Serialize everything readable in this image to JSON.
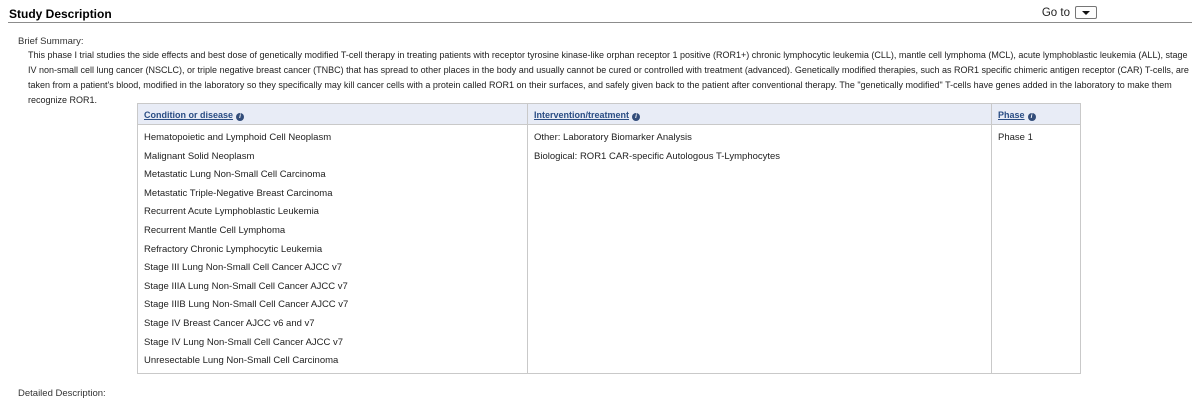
{
  "header": {
    "section_title": "Study Description",
    "goto_label": "Go to"
  },
  "brief_summary": {
    "label": "Brief Summary:",
    "text": "This phase I trial studies the side effects and best dose of genetically modified T-cell therapy in treating patients with receptor tyrosine kinase-like orphan receptor 1 positive (ROR1+) chronic lymphocytic leukemia (CLL), mantle cell lymphoma (MCL), acute lymphoblastic leukemia (ALL), stage IV non-small cell lung cancer (NSCLC), or triple negative breast cancer (TNBC) that has spread to other places in the body and usually cannot be cured or controlled with treatment (advanced). Genetically modified therapies, such as ROR1 specific chimeric antigen receptor (CAR) T-cells, are taken from a patient's blood, modified in the laboratory so they specifically may kill cancer cells with a protein called ROR1 on their surfaces, and safely given back to the patient after conventional therapy. The \"genetically modified\" T-cells have genes added in the laboratory to make them recognize ROR1."
  },
  "table": {
    "headers": {
      "condition": "Condition or disease",
      "intervention": "Intervention/treatment",
      "phase": "Phase"
    },
    "conditions": [
      "Hematopoietic and Lymphoid Cell Neoplasm",
      "Malignant Solid Neoplasm",
      "Metastatic Lung Non-Small Cell Carcinoma",
      "Metastatic Triple-Negative Breast Carcinoma",
      "Recurrent Acute Lymphoblastic Leukemia",
      "Recurrent Mantle Cell Lymphoma",
      "Refractory Chronic Lymphocytic Leukemia",
      "Stage III Lung Non-Small Cell Cancer AJCC v7",
      "Stage IIIA Lung Non-Small Cell Cancer AJCC v7",
      "Stage IIIB Lung Non-Small Cell Cancer AJCC v7",
      "Stage IV Breast Cancer AJCC v6 and v7",
      "Stage IV Lung Non-Small Cell Cancer AJCC v7",
      "Unresectable Lung Non-Small Cell Carcinoma"
    ],
    "interventions": [
      "Other: Laboratory Biomarker Analysis",
      "Biological: ROR1 CAR-specific Autologous T-Lymphocytes"
    ],
    "phases": [
      "Phase 1"
    ]
  },
  "detailed_description": {
    "label": "Detailed Description:"
  },
  "colors": {
    "header_bg": "#e8ecf6",
    "header_text": "#2a4d84",
    "border": "#c9c9c9"
  },
  "icons": {
    "info": "info-circle-icon",
    "dropdown": "chevron-down-icon"
  }
}
